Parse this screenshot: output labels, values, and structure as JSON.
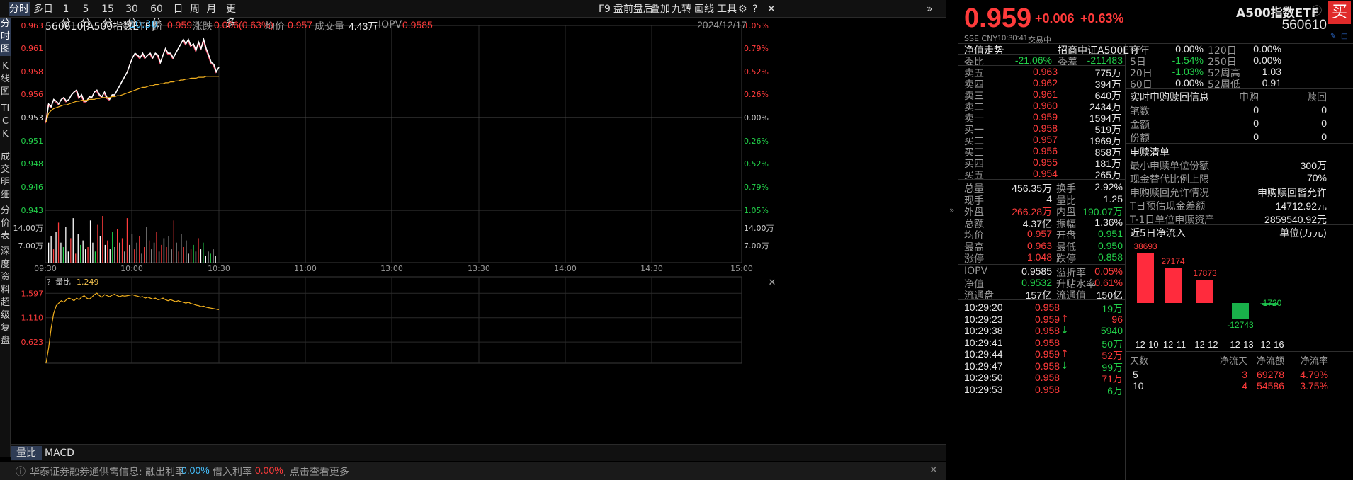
{
  "toolbar": {
    "tabs": [
      "分时",
      "多日",
      "1分",
      "5分",
      "15分",
      "30分",
      "60分",
      "日",
      "周",
      "月",
      "更多"
    ],
    "right_items": [
      "F9",
      "盘前盘后",
      "叠加",
      "九转",
      "画线",
      "工具"
    ]
  },
  "side_tabs": [
    "分时图",
    "K线图",
    "TICK",
    "成交明细",
    "分价表",
    "深度资料",
    "超级复盘"
  ],
  "info": {
    "code_name": "560610[A500指数ETF]",
    "time": "10:30",
    "price_label": "价",
    "price": "0.959",
    "change_label": "涨跌",
    "change": "0.006(0.63%)",
    "avg_label": "均价",
    "avg": "0.957",
    "vol_label": "成交量",
    "vol": "4.43万",
    "iopv_label": "IOPV",
    "iopv": "0.9585",
    "date": "2024/12/17"
  },
  "chart_data": {
    "type": "line",
    "title": "",
    "x_ticks": [
      "09:30",
      "10:00",
      "10:30",
      "11:00",
      "13:00",
      "13:30",
      "14:00",
      "14:30",
      "15:00"
    ],
    "y_price_ticks": [
      "0.963",
      "0.961",
      "0.958",
      "0.956",
      "0.953",
      "0.951",
      "0.948",
      "0.946",
      "0.943"
    ],
    "y_pct_ticks": [
      "1.05%",
      "0.79%",
      "0.52%",
      "0.26%",
      "0.00%",
      "0.26%",
      "0.52%",
      "0.79%",
      "1.05%"
    ],
    "ylim": [
      0.943,
      0.963
    ],
    "prev_close": 0.953,
    "price_series": [
      0.9525,
      0.9545,
      0.9542,
      0.955,
      0.9548,
      0.9545,
      0.955,
      0.9552,
      0.9548,
      0.955,
      0.9555,
      0.9558,
      0.956,
      0.9552,
      0.9555,
      0.9548,
      0.9548,
      0.9553,
      0.9552,
      0.9558,
      0.956,
      0.9555,
      0.9553,
      0.9558,
      0.9552,
      0.955,
      0.9555,
      0.9555,
      0.956,
      0.9565,
      0.957,
      0.9575,
      0.958,
      0.9588,
      0.9595,
      0.96,
      0.9598,
      0.9595,
      0.96,
      0.9595,
      0.9598,
      0.96,
      0.9595,
      0.96,
      0.9598,
      0.959,
      0.9598,
      0.9605,
      0.96,
      0.96,
      0.9595,
      0.96,
      0.9605,
      0.961,
      0.9615,
      0.961,
      0.9615,
      0.9608,
      0.961,
      0.9603,
      0.9612,
      0.9605,
      0.9615,
      0.9605,
      0.9598,
      0.959,
      0.9588,
      0.958,
      0.9585
    ],
    "avg_series": [
      0.9525,
      0.9535,
      0.9538,
      0.954,
      0.9541,
      0.9542,
      0.9543,
      0.9544,
      0.9544,
      0.9545,
      0.9546,
      0.9547,
      0.9548,
      0.9548,
      0.9549,
      0.9549,
      0.9549,
      0.955,
      0.955,
      0.955,
      0.9551,
      0.9551,
      0.9552,
      0.9552,
      0.9552,
      0.9552,
      0.9553,
      0.9553,
      0.9554,
      0.9554,
      0.9555,
      0.9556,
      0.9557,
      0.9558,
      0.9559,
      0.956,
      0.9561,
      0.9562,
      0.9563,
      0.9563,
      0.9564,
      0.9565,
      0.9565,
      0.9566,
      0.9566,
      0.9567,
      0.9567,
      0.9568,
      0.9568,
      0.9569,
      0.9569,
      0.957,
      0.957,
      0.9571,
      0.9571,
      0.9572,
      0.9572,
      0.9573,
      0.9573,
      0.9573,
      0.9574,
      0.9574,
      0.9574,
      0.9575,
      0.9575,
      0.9575,
      0.9575,
      0.9575,
      0.9575
    ],
    "volume_ticks": [
      "14.00万",
      "7.00万"
    ],
    "volume_max": 21,
    "volume_series": [
      {
        "v": 9,
        "c": "w"
      },
      {
        "v": 12,
        "c": "w"
      },
      {
        "v": 6,
        "c": "r"
      },
      {
        "v": 14,
        "c": "w"
      },
      {
        "v": 18,
        "c": "r"
      },
      {
        "v": 9,
        "c": "w"
      },
      {
        "v": 7,
        "c": "g"
      },
      {
        "v": 16,
        "c": "w"
      },
      {
        "v": 5,
        "c": "w"
      },
      {
        "v": 11,
        "c": "r"
      },
      {
        "v": 20,
        "c": "w"
      },
      {
        "v": 4,
        "c": "r"
      },
      {
        "v": 13,
        "c": "w"
      },
      {
        "v": 8,
        "c": "g"
      },
      {
        "v": 10,
        "c": "w"
      },
      {
        "v": 6,
        "c": "w"
      },
      {
        "v": 7,
        "c": "r"
      },
      {
        "v": 19,
        "c": "w"
      },
      {
        "v": 9,
        "c": "w"
      },
      {
        "v": 5,
        "c": "g"
      },
      {
        "v": 17,
        "c": "r"
      },
      {
        "v": 12,
        "c": "w"
      },
      {
        "v": 21,
        "c": "r"
      },
      {
        "v": 8,
        "c": "w"
      },
      {
        "v": 10,
        "c": "r"
      },
      {
        "v": 6,
        "c": "w"
      },
      {
        "v": 14,
        "c": "g"
      },
      {
        "v": 7,
        "c": "w"
      },
      {
        "v": 15,
        "c": "r"
      },
      {
        "v": 9,
        "c": "w"
      },
      {
        "v": 11,
        "c": "r"
      },
      {
        "v": 5,
        "c": "w"
      },
      {
        "v": 20,
        "c": "r"
      },
      {
        "v": 8,
        "c": "w"
      },
      {
        "v": 13,
        "c": "w"
      },
      {
        "v": 6,
        "c": "r"
      },
      {
        "v": 9,
        "c": "w"
      },
      {
        "v": 12,
        "c": "r"
      },
      {
        "v": 4,
        "c": "w"
      },
      {
        "v": 7,
        "c": "r"
      },
      {
        "v": 16,
        "c": "w"
      },
      {
        "v": 10,
        "c": "r"
      },
      {
        "v": 6,
        "c": "w"
      },
      {
        "v": 9,
        "c": "w"
      },
      {
        "v": 14,
        "c": "r"
      },
      {
        "v": 5,
        "c": "w"
      },
      {
        "v": 8,
        "c": "r"
      },
      {
        "v": 11,
        "c": "w"
      },
      {
        "v": 7,
        "c": "r"
      },
      {
        "v": 12,
        "c": "w"
      },
      {
        "v": 6,
        "c": "w"
      },
      {
        "v": 19,
        "c": "r"
      },
      {
        "v": 9,
        "c": "w"
      },
      {
        "v": 5,
        "c": "r"
      },
      {
        "v": 13,
        "c": "w"
      },
      {
        "v": 7,
        "c": "r"
      },
      {
        "v": 10,
        "c": "w"
      },
      {
        "v": 4,
        "c": "w"
      },
      {
        "v": 6,
        "c": "r"
      },
      {
        "v": 8,
        "c": "g"
      },
      {
        "v": 5,
        "c": "w"
      },
      {
        "v": 11,
        "c": "r"
      },
      {
        "v": 6,
        "c": "w"
      },
      {
        "v": 9,
        "c": "g"
      },
      {
        "v": 3,
        "c": "w"
      },
      {
        "v": 5,
        "c": "w"
      },
      {
        "v": 4,
        "c": "g"
      },
      {
        "v": 6,
        "c": "w"
      },
      {
        "v": 3,
        "c": "w"
      }
    ],
    "sub_indicator": {
      "name": "量比",
      "value": "1.249",
      "ticks": [
        "1.597",
        "1.110",
        "0.623"
      ],
      "ylim": [
        0.2,
        1.7
      ],
      "series": [
        0.2,
        0.5,
        0.9,
        1.2,
        1.35,
        1.4,
        1.45,
        1.42,
        1.47,
        1.5,
        1.48,
        1.45,
        1.5,
        1.47,
        1.52,
        1.55,
        1.5,
        1.48,
        1.52,
        1.57,
        1.6,
        1.55,
        1.52,
        1.57,
        1.55,
        1.53,
        1.56,
        1.58,
        1.55,
        1.53,
        1.55,
        1.54,
        1.55,
        1.56,
        1.57,
        1.55,
        1.54,
        1.52,
        1.53,
        1.5,
        1.52,
        1.5,
        1.48,
        1.5,
        1.47,
        1.48,
        1.5,
        1.47,
        1.45,
        1.47,
        1.45,
        1.43,
        1.45,
        1.43,
        1.42,
        1.4,
        1.42,
        1.39,
        1.38,
        1.36,
        1.35,
        1.33,
        1.34,
        1.32,
        1.31,
        1.3,
        1.29,
        1.28,
        1.27
      ]
    }
  },
  "sub_tabs": [
    "量比",
    "MACD"
  ],
  "status": {
    "prefix": "华泰证券融券通供需信息: 融出利率",
    "lend_rate": "0.00%",
    "borrow_label": "借入利率",
    "borrow_rate": "0.00%",
    "more": ", 点击查看更多"
  },
  "quote": {
    "price": "0.959",
    "change": "+0.006",
    "pct": "+0.63%",
    "name": "A500指数ETF",
    "code": "560610",
    "market": "SSE  CNY",
    "time": "10:30:41",
    "status": "交易中",
    "buy_label": "买",
    "nav_title": "净值走势",
    "fund_name": "招商中证A500ETF",
    "weibi_label": "委比",
    "weibi": "-21.06%",
    "weicha_label": "委差",
    "weicha": "-211483"
  },
  "asks": [
    {
      "label": "卖五",
      "price": "0.963",
      "vol": "775万"
    },
    {
      "label": "卖四",
      "price": "0.962",
      "vol": "394万"
    },
    {
      "label": "卖三",
      "price": "0.961",
      "vol": "640万"
    },
    {
      "label": "卖二",
      "price": "0.960",
      "vol": "2434万"
    },
    {
      "label": "卖一",
      "price": "0.959",
      "vol": "1594万"
    }
  ],
  "bids": [
    {
      "label": "买一",
      "price": "0.958",
      "vol": "519万"
    },
    {
      "label": "买二",
      "price": "0.957",
      "vol": "1969万"
    },
    {
      "label": "买三",
      "price": "0.956",
      "vol": "858万"
    },
    {
      "label": "买四",
      "price": "0.955",
      "vol": "181万"
    },
    {
      "label": "买五",
      "price": "0.954",
      "vol": "265万"
    }
  ],
  "stats": [
    {
      "l1": "总量",
      "v1": "456.35万",
      "c1": "white",
      "l2": "换手",
      "v2": "2.92%",
      "c2": "white"
    },
    {
      "l1": "现手",
      "v1": "4",
      "c1": "white",
      "l2": "量比",
      "v2": "1.25",
      "c2": "white"
    },
    {
      "l1": "外盘",
      "v1": "266.28万",
      "c1": "red",
      "l2": "内盘",
      "v2": "190.07万",
      "c2": "green"
    },
    {
      "l1": "总额",
      "v1": "4.37亿",
      "c1": "white",
      "l2": "振幅",
      "v2": "1.36%",
      "c2": "white"
    },
    {
      "l1": "均价",
      "v1": "0.957",
      "c1": "red",
      "l2": "开盘",
      "v2": "0.951",
      "c2": "green"
    },
    {
      "l1": "最高",
      "v1": "0.963",
      "c1": "red",
      "l2": "最低",
      "v2": "0.950",
      "c2": "green"
    },
    {
      "l1": "涨停",
      "v1": "1.048",
      "c1": "red",
      "l2": "跌停",
      "v2": "0.858",
      "c2": "green"
    }
  ],
  "stats2": [
    {
      "l1": "IOPV",
      "v1": "0.9585",
      "c1": "white",
      "l2": "溢折率",
      "v2": "0.05%",
      "c2": "red"
    },
    {
      "l1": "净值",
      "v1": "0.9532",
      "c1": "green",
      "l2": "升贴水率",
      "v2": "0.61%",
      "c2": "red"
    },
    {
      "l1": "流通盘",
      "v1": "157亿",
      "c1": "white",
      "l2": "流通值",
      "v2": "150亿",
      "c2": "white"
    }
  ],
  "ticks": [
    {
      "time": "10:29:20",
      "price": "0.958",
      "arrow": "",
      "vol": "19万",
      "vc": "green"
    },
    {
      "time": "10:29:23",
      "price": "0.959",
      "arrow": "↑",
      "vol": "96",
      "vc": "red"
    },
    {
      "time": "10:29:38",
      "price": "0.958",
      "arrow": "↓",
      "vol": "5940",
      "vc": "green"
    },
    {
      "time": "10:29:41",
      "price": "0.958",
      "arrow": "",
      "vol": "50万",
      "vc": "green"
    },
    {
      "time": "10:29:44",
      "price": "0.959",
      "arrow": "↑",
      "vol": "52万",
      "vc": "red"
    },
    {
      "time": "10:29:47",
      "price": "0.958",
      "arrow": "↓",
      "vol": "99万",
      "vc": "green"
    },
    {
      "time": "10:29:50",
      "price": "0.958",
      "arrow": "",
      "vol": "71万",
      "vc": "red"
    },
    {
      "time": "10:29:53",
      "price": "0.958",
      "arrow": "",
      "vol": "6万",
      "vc": "green"
    }
  ],
  "perf": [
    {
      "l1": "今年",
      "v1": "0.00%",
      "c1": "white",
      "l2": "120日",
      "v2": "0.00%",
      "c2": "white"
    },
    {
      "l1": "5日",
      "v1": "-1.54%",
      "c1": "green",
      "l2": "250日",
      "v2": "0.00%",
      "c2": "white"
    },
    {
      "l1": "20日",
      "v1": "-1.03%",
      "c1": "green",
      "l2": "52周高",
      "v2": "1.03",
      "c2": "white"
    },
    {
      "l1": "60日",
      "v1": "0.00%",
      "c1": "white",
      "l2": "52周低",
      "v2": "0.91",
      "c2": "white"
    }
  ],
  "creation": {
    "title": "实时申购赎回信息",
    "col1": "申购",
    "col2": "赎回",
    "rows": [
      {
        "l": "笔数",
        "a": "0",
        "b": "0"
      },
      {
        "l": "金额",
        "a": "0",
        "b": "0"
      },
      {
        "l": "份额",
        "a": "0",
        "b": "0"
      }
    ]
  },
  "pcf": {
    "title": "申赎清单",
    "rows": [
      {
        "l": "最小申赎单位份额",
        "v": "300万"
      },
      {
        "l": "现金替代比例上限",
        "v": "70%"
      },
      {
        "l": "申购赎回允许情况",
        "v": "申购赎回皆允许"
      },
      {
        "l": "T日预估现金差额",
        "v": "14712.92元"
      },
      {
        "l": "T-1日单位申赎资产",
        "v": "2859540.92元"
      }
    ]
  },
  "flow": {
    "title": "近5日净流入",
    "unit": "单位(万元)",
    "chart_data": {
      "type": "bar",
      "categories": [
        "12-10",
        "12-11",
        "12-12",
        "12-13",
        "12-16"
      ],
      "values": [
        38693,
        27174,
        17873,
        -12743,
        -1720
      ]
    },
    "table_headers": [
      "天数",
      "净流天",
      "净流额",
      "净流率"
    ],
    "table_rows": [
      {
        "days": "5",
        "d": "3",
        "amt": "69278",
        "rate": "4.79%"
      },
      {
        "days": "10",
        "d": "4",
        "amt": "54586",
        "rate": "3.75%"
      }
    ]
  }
}
